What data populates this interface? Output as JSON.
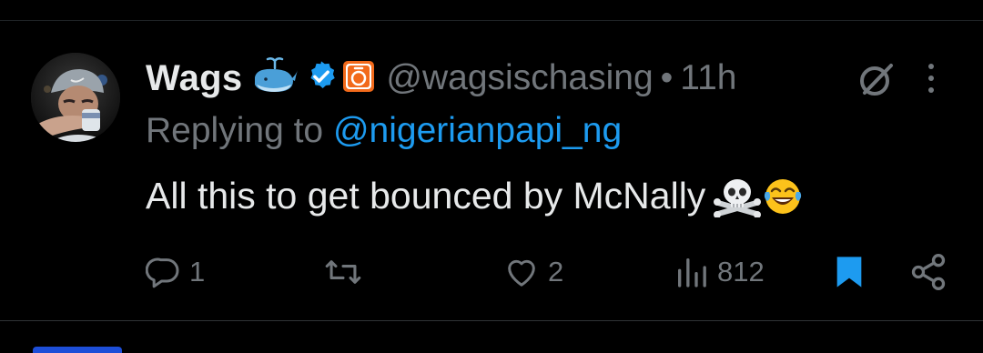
{
  "tweet": {
    "author": {
      "display_name": "Wags",
      "name_emoji_icon": "whale-spouting-emoji",
      "verified_icon": "verified-badge-icon",
      "affiliation_icon": "affiliate-badge-icon",
      "handle": "@wagsischasing",
      "separator": "•",
      "time": "11h",
      "avatar_icon": "avatar-photo"
    },
    "reply_prefix": "Replying to",
    "reply_to": "@nigerianpapi_ng",
    "text": "All this to get bounced by McNally",
    "text_emojis": [
      "skull-crossbones-emoji",
      "tears-of-joy-emoji"
    ],
    "header_actions": {
      "grok_icon": "grok-icon",
      "more_icon": "more-vertical-icon"
    },
    "actions": {
      "reply": {
        "icon": "reply-icon",
        "count": "1"
      },
      "retweet": {
        "icon": "retweet-icon",
        "count": ""
      },
      "like": {
        "icon": "heart-icon",
        "count": "2"
      },
      "views": {
        "icon": "views-icon",
        "count": "812"
      },
      "bookmark": {
        "icon": "bookmark-icon",
        "active": true
      },
      "share": {
        "icon": "share-icon"
      }
    }
  },
  "colors": {
    "background": "#000000",
    "text_primary": "#e7e9ea",
    "text_secondary": "#71767b",
    "accent": "#1d9bf0",
    "affiliate_orange": "#f26a1b"
  }
}
